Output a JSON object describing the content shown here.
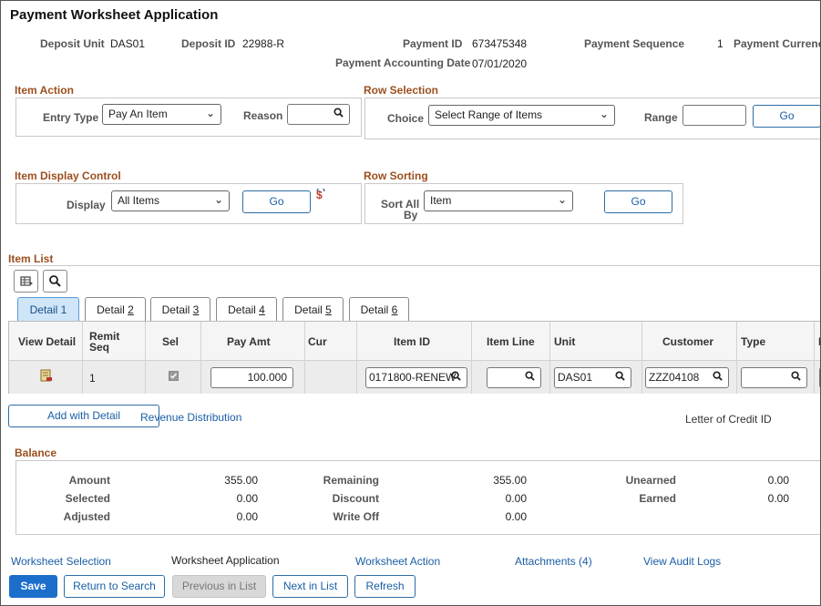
{
  "page": {
    "title": "Payment Worksheet Application"
  },
  "header": {
    "deposit_unit_label": "Deposit Unit",
    "deposit_unit": "DAS01",
    "deposit_id_label": "Deposit ID",
    "deposit_id": "22988-R",
    "payment_id_label": "Payment ID",
    "payment_id": "673475348",
    "payment_sequence_label": "Payment Sequence",
    "payment_sequence": "1",
    "payment_currency_label": "Payment Currency",
    "payment_accounting_date_label": "Payment Accounting Date",
    "payment_accounting_date": "07/01/2020"
  },
  "item_action": {
    "title": "Item Action",
    "entry_type_label": "Entry Type",
    "entry_type": "Pay An Item",
    "reason_label": "Reason"
  },
  "row_selection": {
    "title": "Row Selection",
    "choice_label": "Choice",
    "choice": "Select Range of Items",
    "range_label": "Range",
    "go": "Go"
  },
  "item_display": {
    "title": "Item Display Control",
    "display_label": "Display",
    "display": "All Items",
    "go": "Go"
  },
  "row_sorting": {
    "title": "Row Sorting",
    "sort_label_1": "Sort All",
    "sort_label_2": "By",
    "sort_value": "Item",
    "go": "Go"
  },
  "item_list": {
    "title": "Item List",
    "tabs": [
      {
        "prefix": "Detail ",
        "num": "1"
      },
      {
        "prefix": "Detail ",
        "num": "2"
      },
      {
        "prefix": "Detail ",
        "num": "3"
      },
      {
        "prefix": "Detail ",
        "num": "4"
      },
      {
        "prefix": "Detail ",
        "num": "5"
      },
      {
        "prefix": "Detail ",
        "num": "6"
      }
    ],
    "columns": {
      "view_detail": "View Detail",
      "remit_seq_1": "Remit",
      "remit_seq_2": "Seq",
      "sel": "Sel",
      "pay_amt": "Pay Amt",
      "cur": "Cur",
      "item_id": "Item ID",
      "item_line": "Item Line",
      "unit": "Unit",
      "customer": "Customer",
      "type": "Type",
      "next": "R"
    },
    "row": {
      "remit_seq": "1",
      "pay_amt": "100.000",
      "item_id": "0171800-RENEW",
      "item_line": "",
      "unit": "DAS01",
      "customer": "ZZZ04108",
      "type": ""
    }
  },
  "actions": {
    "add_with_detail": "Add with Detail",
    "revenue_distribution": "Revenue Distribution",
    "letter_of_credit_id": "Letter of Credit ID"
  },
  "balance": {
    "title": "Balance",
    "amount_label": "Amount",
    "amount": "355.00",
    "selected_label": "Selected",
    "selected": "0.00",
    "adjusted_label": "Adjusted",
    "adjusted": "0.00",
    "remaining_label": "Remaining",
    "remaining": "355.00",
    "discount_label": "Discount",
    "discount": "0.00",
    "writeoff_label": "Write Off",
    "writeoff": "0.00",
    "unearned_label": "Unearned",
    "unearned": "0.00",
    "earned_label": "Earned",
    "earned": "0.00"
  },
  "footer_links": {
    "worksheet_selection": "Worksheet Selection",
    "worksheet_application": "Worksheet Application",
    "worksheet_action": "Worksheet Action",
    "attachments": "Attachments (4)",
    "view_audit_logs": "View Audit Logs"
  },
  "buttons": {
    "save": "Save",
    "return_to_search": "Return to Search",
    "previous_in_list": "Previous in List",
    "next_in_list": "Next in List",
    "refresh": "Refresh"
  },
  "colors": {
    "section_title": "#9b4f1e",
    "link": "#1a5ea5",
    "primary": "#1c6ecb",
    "active_tab": "#cfe5f8"
  }
}
